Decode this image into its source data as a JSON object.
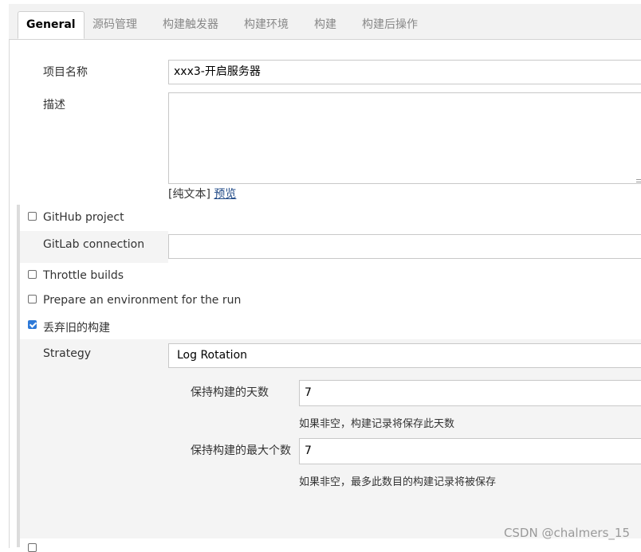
{
  "tabs": [
    {
      "label": "General",
      "active": true
    },
    {
      "label": "源码管理"
    },
    {
      "label": "构建触发器"
    },
    {
      "label": "构建环境"
    },
    {
      "label": "构建"
    },
    {
      "label": "构建后操作"
    }
  ],
  "general": {
    "project_name_label": "项目名称",
    "project_name_value": "xxx3-开启服务器",
    "description_label": "描述",
    "description_value": "",
    "format_prefix": "[纯文本]",
    "preview_link": "预览"
  },
  "options": {
    "github_project": {
      "label": "GitHub project",
      "checked": false
    },
    "gitlab_connection": {
      "label": "GitLab connection",
      "value": ""
    },
    "throttle_builds": {
      "label": "Throttle builds",
      "checked": false
    },
    "prepare_env": {
      "label": "Prepare an environment for the run",
      "checked": false
    },
    "discard_old": {
      "label": "丢弃旧的构建",
      "checked": true
    }
  },
  "strategy": {
    "label": "Strategy",
    "value": "Log Rotation",
    "days_label": "保持构建的天数",
    "days_value": "7",
    "days_hint": "如果非空，构建记录将保存此天数",
    "max_label": "保持构建的最大个数",
    "max_value": "7",
    "max_hint": "如果非空，最多此数目的构建记录将被保存"
  },
  "watermark": "CSDN @chalmers_15",
  "colors": {
    "tab_bg": "#f2f2f2",
    "link": "#204a87",
    "checkbox_checked": "#2d79d8",
    "section_bg": "#f4f4f4"
  }
}
